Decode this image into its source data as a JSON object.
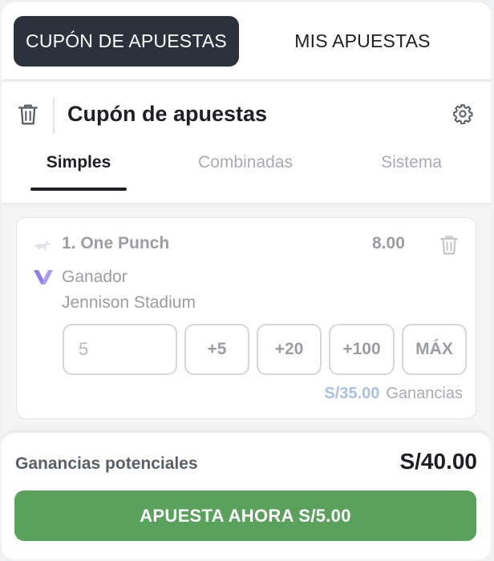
{
  "tabs": {
    "active": "CUPÓN DE APUESTAS",
    "inactive": "MIS APUESTAS"
  },
  "header": {
    "title": "Cupón de apuestas",
    "sub_tabs": [
      "Simples",
      "Combinadas",
      "Sistema"
    ],
    "active_sub_tab": "Simples",
    "icons": {
      "delete": "trash-icon",
      "settings": "gear-icon"
    }
  },
  "bet": {
    "selection": "1. One Punch",
    "odds": "8.00",
    "market": "Ganador",
    "event": "Jennison Stadium",
    "stake_value": "5",
    "quick_stakes": [
      "+5",
      "+20",
      "+100",
      "MÁX"
    ],
    "payout_amount": "S/35.00",
    "payout_label": "Ganancias",
    "icons": {
      "sport": "greyhound-icon",
      "brand": "v-logo-icon",
      "delete": "trash-icon"
    }
  },
  "footer": {
    "potential_label": "Ganancias potenciales",
    "potential_value": "S/40.00",
    "cta_label": "APUESTA AHORA S/5.00"
  },
  "colors": {
    "active_tab_bg": "#2b323b",
    "cta_green": "#5aa25c",
    "payout_blue": "#a9c0e2",
    "brand_purple": "#a99af0",
    "muted_text": "#9a9da2"
  }
}
